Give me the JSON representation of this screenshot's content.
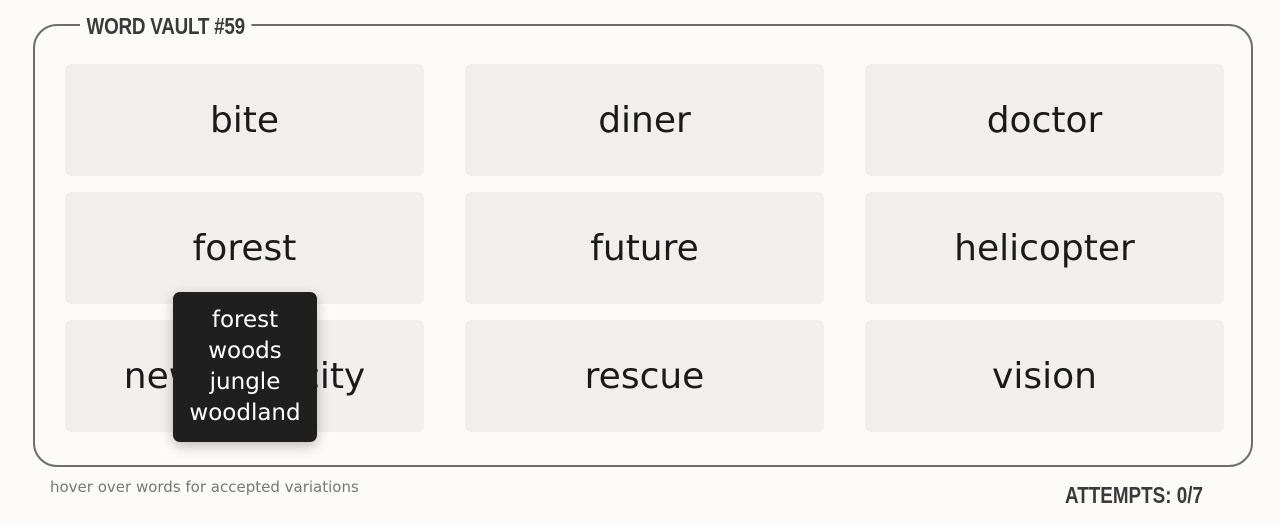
{
  "title": "WORD VAULT #59",
  "tiles": [
    "bite",
    "diner",
    "doctor",
    "forest",
    "future",
    "helicopter",
    "new york city",
    "rescue",
    "vision"
  ],
  "tooltip": {
    "variations": [
      "forest",
      "woods",
      "jungle",
      "woodland"
    ]
  },
  "hint": "hover over words for accepted variations",
  "attempts": "ATTEMPTS: 0/7"
}
